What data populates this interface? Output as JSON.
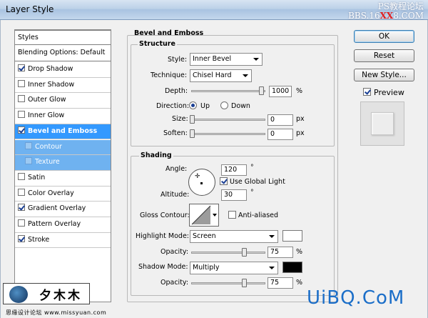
{
  "window": {
    "title": "Layer Style",
    "watermark_line1": "PS教程论坛",
    "watermark_line2_pre": "BBS.16",
    "watermark_line2_red": "XX",
    "watermark_line2_post": "8.COM"
  },
  "styles_list": {
    "header": "Styles",
    "blending": "Blending Options: Default",
    "items": [
      {
        "label": "Drop Shadow",
        "checked": true
      },
      {
        "label": "Inner Shadow",
        "checked": false
      },
      {
        "label": "Outer Glow",
        "checked": false
      },
      {
        "label": "Inner Glow",
        "checked": false
      },
      {
        "label": "Bevel and Emboss",
        "checked": true
      },
      {
        "label": "Contour",
        "checked": false
      },
      {
        "label": "Texture",
        "checked": false
      },
      {
        "label": "Satin",
        "checked": false
      },
      {
        "label": "Color Overlay",
        "checked": false
      },
      {
        "label": "Gradient Overlay",
        "checked": true
      },
      {
        "label": "Pattern Overlay",
        "checked": false
      },
      {
        "label": "Stroke",
        "checked": true
      }
    ]
  },
  "bevel": {
    "group_title": "Bevel and Emboss",
    "structure_title": "Structure",
    "style_label": "Style:",
    "style_value": "Inner Bevel",
    "technique_label": "Technique:",
    "technique_value": "Chisel Hard",
    "depth_label": "Depth:",
    "depth_value": "1000",
    "depth_unit": "%",
    "direction_label": "Direction:",
    "dir_up": "Up",
    "dir_down": "Down",
    "size_label": "Size:",
    "size_value": "0",
    "size_unit": "px",
    "soften_label": "Soften:",
    "soften_value": "0",
    "soften_unit": "px"
  },
  "shading": {
    "title": "Shading",
    "angle_label": "Angle:",
    "angle_value": "120",
    "angle_unit": "°",
    "global_light": "Use Global Light",
    "altitude_label": "Altitude:",
    "altitude_value": "30",
    "altitude_unit": "°",
    "gloss_label": "Gloss Contour:",
    "anti_aliased": "Anti-aliased",
    "highlight_label": "Highlight Mode:",
    "highlight_value": "Screen",
    "highlight_color": "#ffffff",
    "hl_opacity_label": "Opacity:",
    "hl_opacity_value": "75",
    "hl_opacity_unit": "%",
    "shadow_label": "Shadow Mode:",
    "shadow_value": "Multiply",
    "shadow_color": "#000000",
    "sh_opacity_label": "Opacity:",
    "sh_opacity_value": "75",
    "sh_opacity_unit": "%"
  },
  "buttons": {
    "ok": "OK",
    "reset": "Reset",
    "new_style": "New Style...",
    "preview": "Preview"
  },
  "watermarks": {
    "logo_text": "夕木木",
    "bottom_url": "思缘设计论坛 www.missyuan.com",
    "brand": "UiBQ.CoM"
  }
}
